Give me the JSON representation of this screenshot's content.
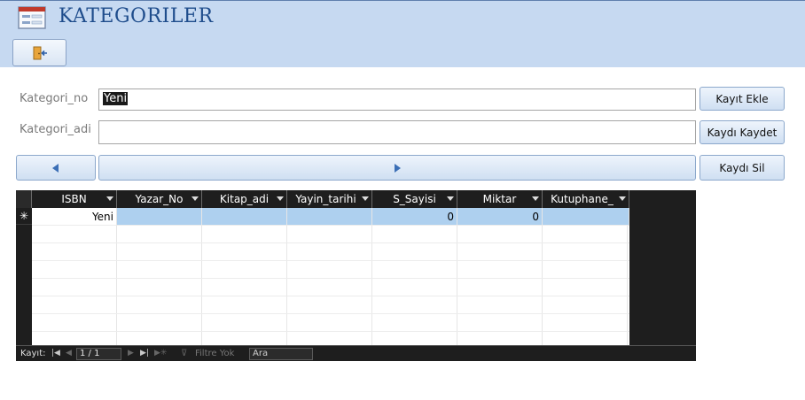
{
  "header": {
    "title": "KATEGORILER",
    "form_icon": "form-icon",
    "exit_icon": "exit-door-icon"
  },
  "form": {
    "kategori_no_label": "Kategori_no",
    "kategori_no_value": "Yeni",
    "kategori_adi_label": "Kategori_adi",
    "kategori_adi_value": ""
  },
  "buttons": {
    "kayit_ekle": "Kayıt Ekle",
    "kaydi_kaydet": "Kaydı Kaydet",
    "kaydi_sil": "Kaydı Sil",
    "prev_icon": "triangle-left-icon",
    "next_icon": "triangle-right-icon"
  },
  "subform": {
    "columns": [
      "ISBN",
      "Yazar_No",
      "Kitap_adi",
      "Yayin_tarihi",
      "S_Sayisi",
      "Miktar",
      "Kutuphane_"
    ],
    "new_row": {
      "selector": "✳",
      "values": [
        "Yeni",
        "",
        "",
        "",
        "0",
        "0",
        ""
      ]
    },
    "navigator": {
      "record_label": "Kayıt:",
      "position": "1 / 1",
      "filter_label": "Filtre Yok",
      "search_placeholder": "Ara"
    }
  },
  "colors": {
    "header_bg": "#c6d9f1",
    "title_color": "#1f4d8c",
    "grid_bg": "#1e1e1e",
    "highlight": "#aed0ef"
  }
}
